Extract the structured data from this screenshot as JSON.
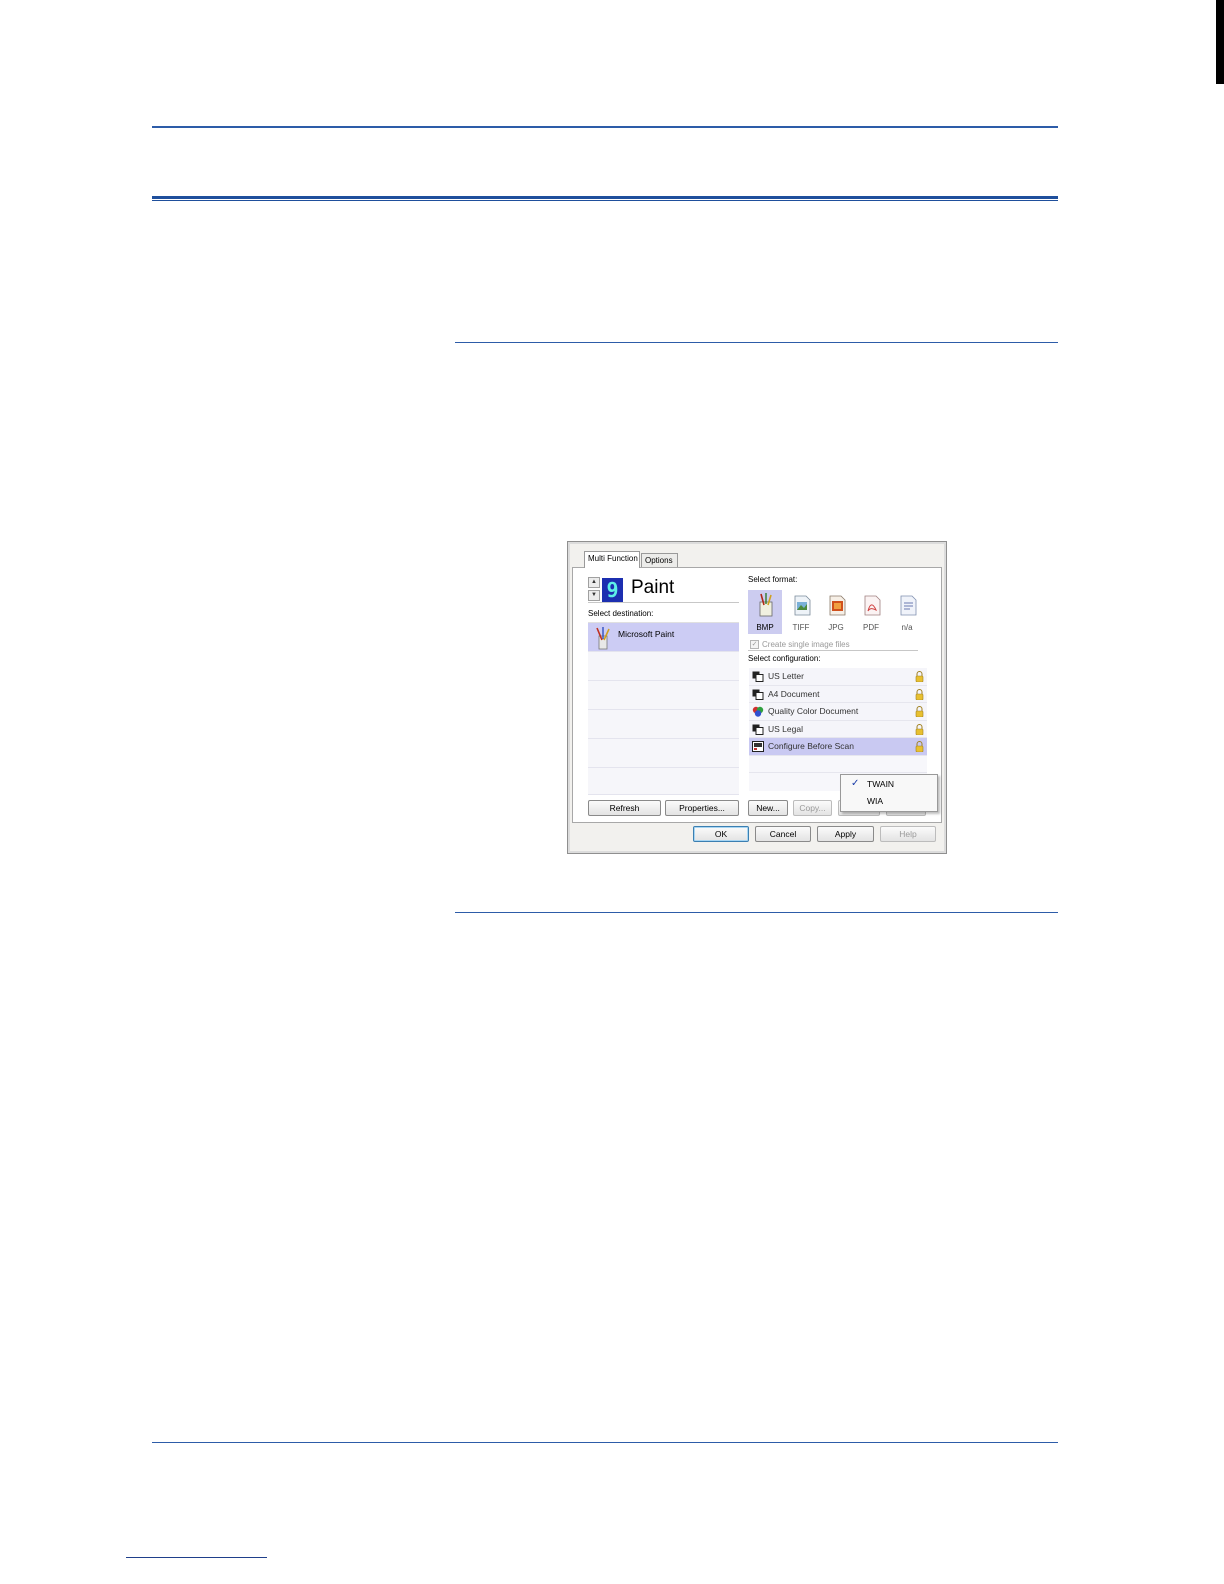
{
  "dialog": {
    "tabs": [
      "Multi Function",
      "Options"
    ],
    "destination": {
      "number": "9",
      "name": "Paint",
      "label": "Select destination:",
      "items": [
        "Microsoft Paint",
        "",
        "",
        "",
        "",
        ""
      ],
      "refresh_label": "Refresh",
      "properties_label": "Properties..."
    },
    "format": {
      "label": "Select format:",
      "items": [
        {
          "label": "BMP",
          "icon": "bmp-paint-icon",
          "selected": true
        },
        {
          "label": "TIFF",
          "icon": "tiff-image-icon",
          "selected": false
        },
        {
          "label": "JPG",
          "icon": "jpg-image-icon",
          "selected": false
        },
        {
          "label": "PDF",
          "icon": "pdf-document-icon",
          "selected": false
        },
        {
          "label": "n/a",
          "icon": "text-document-icon",
          "selected": false
        }
      ],
      "single_image_label": "Create single image files",
      "single_image_checked": true
    },
    "configuration": {
      "label": "Select configuration:",
      "items": [
        {
          "label": "US Letter",
          "icon": "bw-document-icon"
        },
        {
          "label": "A4 Document",
          "icon": "bw-document-icon"
        },
        {
          "label": "Quality Color Document",
          "icon": "color-document-icon"
        },
        {
          "label": "US Legal",
          "icon": "bw-document-icon"
        },
        {
          "label": "Configure Before Scan",
          "icon": "scanner-configure-icon"
        }
      ],
      "new_label": "New...",
      "copy_label": "Copy...",
      "edit_label": "Edit...",
      "delete_label": "Delete"
    },
    "popup": {
      "items": [
        "TWAIN",
        "WIA"
      ],
      "checked": "TWAIN"
    },
    "footer": {
      "ok_label": "OK",
      "cancel_label": "Cancel",
      "apply_label": "Apply",
      "help_label": "Help"
    },
    "colors": {
      "selection": "#ccccf4",
      "rule": "#2d5ca8"
    }
  }
}
